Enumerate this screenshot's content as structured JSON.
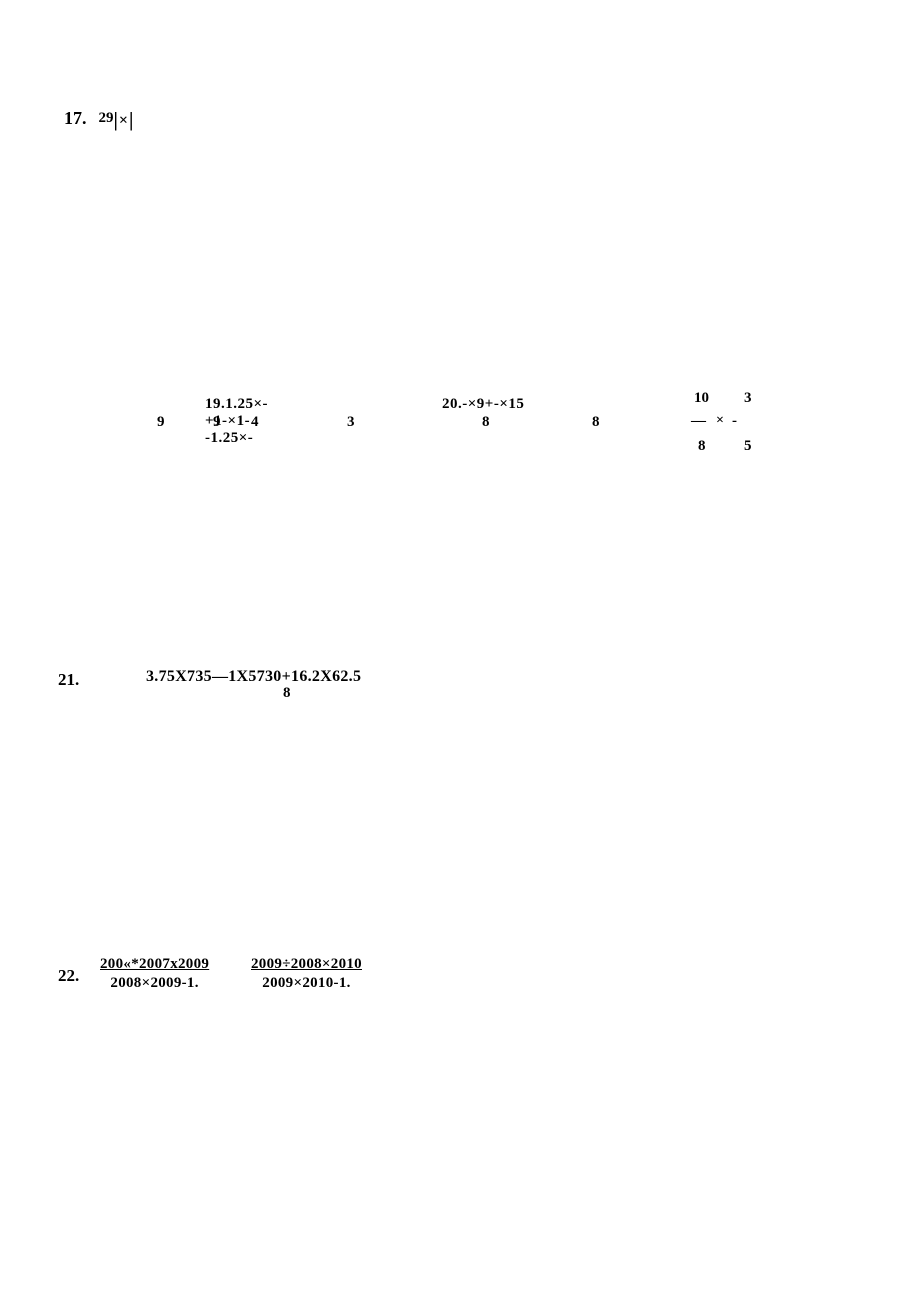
{
  "p17": {
    "number": "17.",
    "sup": "29",
    "barL": "|",
    "times": "×",
    "barR": "|"
  },
  "p19": {
    "expr": "19.1.25×-+1-×1--1.25×-",
    "d9a": "9",
    "d9b": "9",
    "d4": "4",
    "d3": "3"
  },
  "p20": {
    "expr": "20.-×9+-×15",
    "d8a": "8",
    "d8b": "8"
  },
  "frac": {
    "t10": "10",
    "t3": "3",
    "line": "—",
    "times": "×",
    "dash": "-",
    "b8": "8",
    "b5": "5"
  },
  "p21": {
    "number": "21.",
    "expr": "3.75X735—1X5730+16.2X62.5",
    "sub8": "8"
  },
  "p22": {
    "number": "22.",
    "f1top": "200«*2007x2009",
    "f1bot": "2008×2009-1.",
    "f2top": "2009÷2008×2010",
    "f2bot": "2009×2010-1."
  }
}
